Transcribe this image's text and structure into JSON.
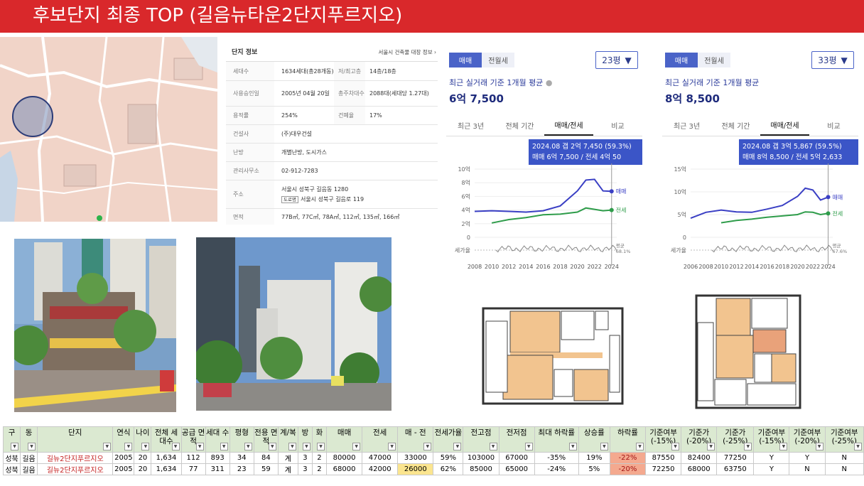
{
  "header": {
    "title": "후보단지 최종 TOP (길음뉴타운2단지푸르지오)"
  },
  "info": {
    "title": "단지 정보",
    "link": "서울시 건축물 대장 정보 ›",
    "households_label": "세대수",
    "households": "1634세대(총28개동)",
    "floors_label": "저/최고층",
    "floors": "14층/18층",
    "approval_label": "사용승인일",
    "approval": "2005년 04월 20일",
    "parking_label": "총주차대수",
    "parking": "2088대(세대당 1.27대)",
    "far_label": "용적률",
    "far": "254%",
    "bcr_label": "건폐율",
    "bcr": "17%",
    "builder_label": "건설사",
    "builder": "(주)대우건설",
    "heating_label": "난방",
    "heating": "개별난방, 도시가스",
    "office_label": "관리사무소",
    "office": "02-912-7283",
    "address_label": "주소",
    "address1": "서울시 성북구 길음동 1280",
    "road_tag": "도로명",
    "address2": "서울시 성북구 길음로 119",
    "area_label": "면적",
    "area": "77B㎡, 77C㎡, 78A㎡, 112㎡, 135㎡, 166㎡"
  },
  "panel1": {
    "tab_sale": "매매",
    "tab_rent": "전월세",
    "size": "23평",
    "avg_label": "최근 실거래 기준 1개월 평균",
    "avg_value": "6억 7,500",
    "periods": [
      "최근 3년",
      "전체 기간",
      "매매/전세",
      "비교"
    ],
    "tooltip_line1": "2024.08  갭 2억 7,450 (59.3%)",
    "tooltip_line2": "매매 6억 7,500 / 전세 4억 50"
  },
  "panel2": {
    "tab_sale": "매매",
    "tab_rent": "전월세",
    "size": "33평",
    "avg_label": "최근 실거래 기준 1개월 평균",
    "avg_value": "8억 8,500",
    "periods": [
      "최근 3년",
      "전체 기간",
      "매매/전세",
      "비교"
    ],
    "tooltip_line1": "2024.08  갭 3억 5,867 (59.5%)",
    "tooltip_line2": "매매 8억 8,500 / 전세 5억 2,633"
  },
  "chart_data": [
    {
      "type": "line",
      "x": [
        2008,
        2010,
        2012,
        2014,
        2016,
        2018,
        2020,
        2021,
        2022,
        2023,
        2024
      ],
      "y_ticks": [
        "0",
        "2억",
        "4억",
        "6억",
        "8억",
        "10억"
      ],
      "x_ticks": [
        "2008",
        "2010",
        "2012",
        "2014",
        "2016",
        "2018",
        "2020",
        "2022",
        "2024"
      ],
      "ylim": [
        0,
        10
      ],
      "series": [
        {
          "name": "매매",
          "color": "#3a3fc4",
          "values": [
            3.8,
            3.9,
            3.8,
            3.7,
            3.9,
            4.6,
            6.8,
            8.4,
            8.5,
            6.8,
            6.75
          ]
        },
        {
          "name": "전세",
          "color": "#2e9c4a",
          "values": [
            null,
            2.1,
            2.6,
            2.9,
            3.3,
            3.4,
            3.7,
            4.3,
            4.1,
            3.9,
            4.0
          ]
        }
      ],
      "bottom_label": "세가율",
      "bottom_note": "평균",
      "bottom_value": "68.1%"
    },
    {
      "type": "line",
      "x": [
        2006,
        2008,
        2010,
        2012,
        2014,
        2016,
        2018,
        2020,
        2021,
        2022,
        2023,
        2024
      ],
      "y_ticks": [
        "0",
        "5억",
        "10억",
        "15억"
      ],
      "x_ticks": [
        "2006",
        "2008",
        "2010",
        "2012",
        "2014",
        "2016",
        "2018",
        "2020",
        "2022",
        "2024"
      ],
      "ylim": [
        0,
        15
      ],
      "series": [
        {
          "name": "매매",
          "color": "#3a3fc4",
          "values": [
            4.2,
            5.5,
            6.0,
            5.6,
            5.5,
            6.2,
            7.0,
            9.0,
            10.8,
            10.4,
            8.2,
            8.85
          ]
        },
        {
          "name": "전세",
          "color": "#2e9c4a",
          "values": [
            null,
            null,
            3.2,
            3.7,
            4.0,
            4.4,
            4.7,
            5.0,
            5.6,
            5.5,
            5.0,
            5.26
          ]
        }
      ],
      "bottom_label": "세가율",
      "bottom_note": "평균",
      "bottom_value": "67.6%"
    }
  ],
  "table": {
    "headers": [
      "구",
      "동",
      "단지",
      "연식",
      "나이",
      "전체 세대수",
      "공급 면적",
      "세대 수",
      "평형",
      "전용 면적",
      "계/복",
      "방",
      "화",
      "매매",
      "전세",
      "매 - 전",
      "전세가율",
      "전고점",
      "전저점",
      "최대 하락률",
      "상승률",
      "하락률",
      "기준여부 (-15%)",
      "기준가 (-20%)",
      "기준가 (-25%)",
      "기준여부 (-15%)",
      "기준여부 (-20%)",
      "기준여부 (-25%)"
    ],
    "rows": [
      [
        "성북",
        "길음",
        "길뉴2단지푸르지오",
        "2005",
        "20",
        "1,634",
        "112",
        "893",
        "34",
        "84",
        "계",
        "3",
        "2",
        "80000",
        "47000",
        "33000",
        "59%",
        "103000",
        "67000",
        "-35%",
        "19%",
        "-22%",
        "87550",
        "82400",
        "77250",
        "Y",
        "Y",
        "N"
      ],
      [
        "성북",
        "길음",
        "길뉴2단지푸르지오",
        "2005",
        "20",
        "1,634",
        "77",
        "311",
        "23",
        "59",
        "계",
        "3",
        "2",
        "68000",
        "42000",
        "26000",
        "62%",
        "85000",
        "65000",
        "-24%",
        "5%",
        "-20%",
        "72250",
        "68000",
        "63750",
        "Y",
        "N",
        "N"
      ]
    ]
  }
}
